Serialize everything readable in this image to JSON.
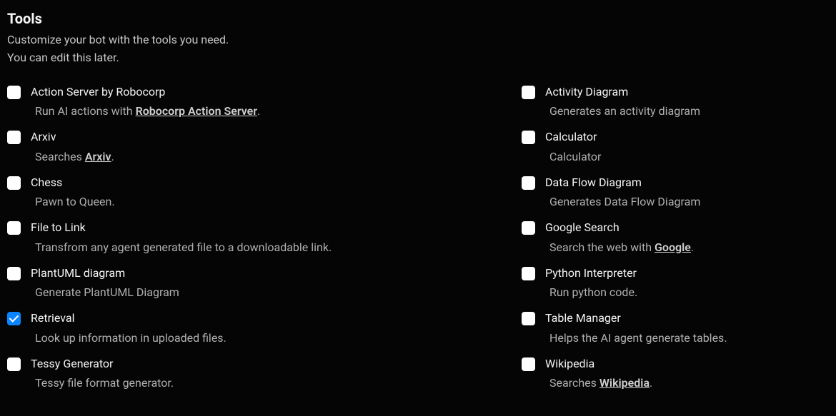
{
  "header": {
    "title": "Tools",
    "subtitle_line1": "Customize your bot with the tools you need.",
    "subtitle_line2": "You can edit this later."
  },
  "tools_left": [
    {
      "id": "action-server",
      "name": "Action Server by Robocorp",
      "checked": false,
      "desc_parts": [
        "Run AI actions with ",
        "Robocorp Action Server",
        "."
      ],
      "link_index": 1
    },
    {
      "id": "arxiv",
      "name": "Arxiv",
      "checked": false,
      "desc_parts": [
        "Searches ",
        "Arxiv",
        "."
      ],
      "link_index": 1
    },
    {
      "id": "chess",
      "name": "Chess",
      "checked": false,
      "desc_parts": [
        "Pawn to Queen."
      ],
      "link_index": -1
    },
    {
      "id": "file-to-link",
      "name": "File to Link",
      "checked": false,
      "desc_parts": [
        "Transfrom any agent generated file to a downloadable link."
      ],
      "link_index": -1
    },
    {
      "id": "plantuml",
      "name": "PlantUML diagram",
      "checked": false,
      "desc_parts": [
        "Generate PlantUML Diagram"
      ],
      "link_index": -1
    },
    {
      "id": "retrieval",
      "name": "Retrieval",
      "checked": true,
      "desc_parts": [
        "Look up information in uploaded files."
      ],
      "link_index": -1
    },
    {
      "id": "tessy-generator",
      "name": "Tessy Generator",
      "checked": false,
      "desc_parts": [
        "Tessy file format generator."
      ],
      "link_index": -1
    }
  ],
  "tools_right": [
    {
      "id": "activity-diagram",
      "name": "Activity Diagram",
      "checked": false,
      "desc_parts": [
        "Generates an activity diagram"
      ],
      "link_index": -1
    },
    {
      "id": "calculator",
      "name": "Calculator",
      "checked": false,
      "desc_parts": [
        "Calculator"
      ],
      "link_index": -1
    },
    {
      "id": "data-flow-diagram",
      "name": "Data Flow Diagram",
      "checked": false,
      "desc_parts": [
        "Generates Data Flow Diagram"
      ],
      "link_index": -1
    },
    {
      "id": "google-search",
      "name": "Google Search",
      "checked": false,
      "desc_parts": [
        "Search the web with ",
        "Google",
        "."
      ],
      "link_index": 1
    },
    {
      "id": "python-interpreter",
      "name": "Python Interpreter",
      "checked": false,
      "desc_parts": [
        "Run python code."
      ],
      "link_index": -1
    },
    {
      "id": "table-manager",
      "name": "Table Manager",
      "checked": false,
      "desc_parts": [
        "Helps the AI agent generate tables."
      ],
      "link_index": -1
    },
    {
      "id": "wikipedia",
      "name": "Wikipedia",
      "checked": false,
      "desc_parts": [
        "Searches ",
        "Wikipedia",
        "."
      ],
      "link_index": 1
    }
  ]
}
